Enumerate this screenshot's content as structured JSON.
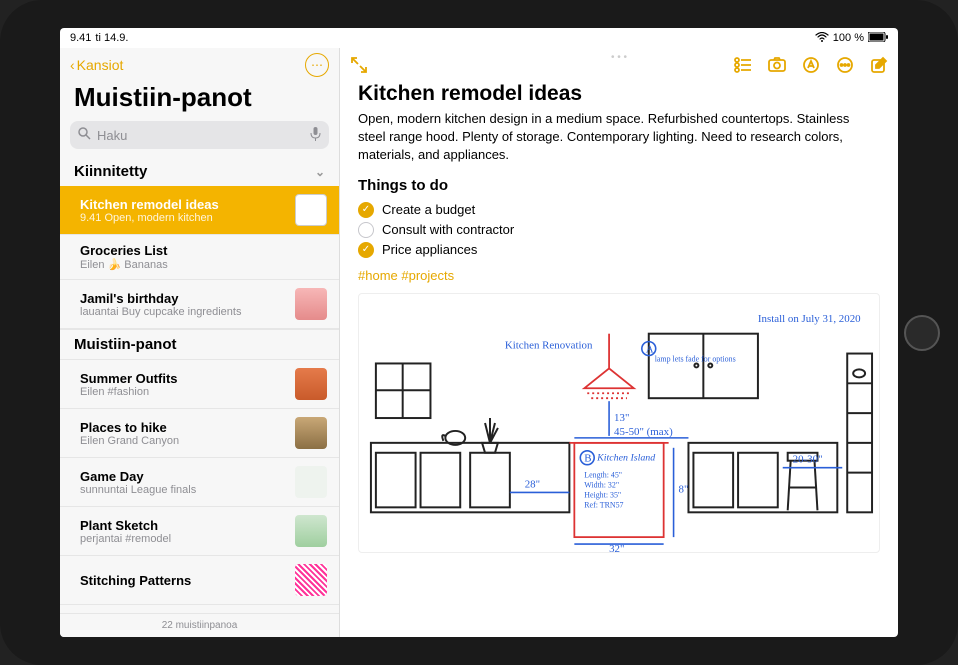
{
  "status": {
    "time": "9.41",
    "date": "ti 14.9.",
    "wifi": "wifi-icon",
    "battery_pct": "100 %",
    "battery_icon": "battery-full"
  },
  "sidebar": {
    "back_label": "Kansiot",
    "title": "Muistiin-panot",
    "search_placeholder": "Haku",
    "pinned_header": "Kiinnitetty",
    "notes_header": "Muistiin-panot",
    "pinned": [
      {
        "title": "Kitchen remodel ideas",
        "subtitle": "9.41  Open, modern kitchen",
        "selected": true,
        "thumb": "remodel"
      },
      {
        "title": "Groceries List",
        "subtitle": "Eilen 🍌 Bananas",
        "thumb": ""
      },
      {
        "title": "Jamil's birthday",
        "subtitle": "lauantai Buy cupcake ingredients",
        "thumb": "cake"
      }
    ],
    "notes": [
      {
        "title": "Summer Outfits",
        "subtitle": "Eilen #fashion",
        "thumb": "outfit"
      },
      {
        "title": "Places to hike",
        "subtitle": "Eilen Grand Canyon",
        "thumb": "hike"
      },
      {
        "title": "Game Day",
        "subtitle": "sunnuntai League finals",
        "thumb": "game"
      },
      {
        "title": "Plant Sketch",
        "subtitle": "perjantai #remodel",
        "thumb": "plant"
      },
      {
        "title": "Stitching Patterns",
        "subtitle": "",
        "thumb": "pattern"
      }
    ],
    "footer_count": "22 muistiinpanoa"
  },
  "content": {
    "title": "Kitchen remodel ideas",
    "description": "Open, modern kitchen design in a medium space. Refurbished countertops. Stainless steel range hood. Plenty of storage. Contemporary lighting. Need to research colors, materials, and appliances.",
    "section_things": "Things to do",
    "checklist": [
      {
        "text": "Create a budget",
        "checked": true
      },
      {
        "text": "Consult with contractor",
        "checked": false
      },
      {
        "text": "Price appliances",
        "checked": true
      }
    ],
    "tags": "#home #projects",
    "sketch": {
      "title": "Kitchen Renovation",
      "install_date": "Install on July 31, 2020",
      "island_label": "Kitchen Island",
      "island_specs": "Length: 45\"\nWidth: 32\"\nHeight: 35\"\nRef: TRN57",
      "dim_28": "28\"",
      "dim_32": "32\"",
      "dim_8": "8\"",
      "dim_45_50": "45-50\" (max)",
      "dim_20_30": "20-30\"",
      "dim_13": "13\"",
      "lamp_note": "lamp\nlets\nfade\nfor\noptions",
      "circle_a": "A",
      "circle_b": "B"
    }
  },
  "colors": {
    "accent": "#e6a800"
  }
}
